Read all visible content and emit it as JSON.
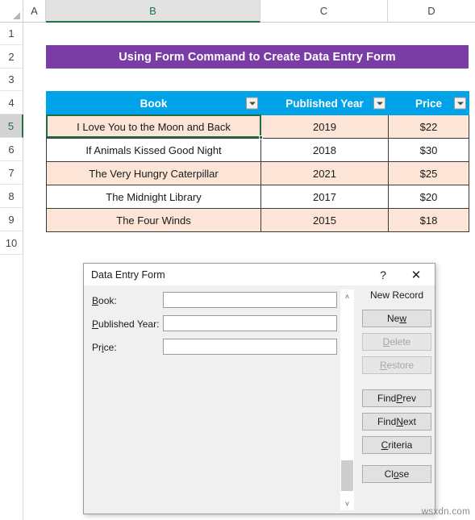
{
  "spreadsheet": {
    "columns": [
      {
        "label": "A",
        "active": false
      },
      {
        "label": "B",
        "active": true
      },
      {
        "label": "C",
        "active": false
      },
      {
        "label": "D",
        "active": false
      }
    ],
    "rows": [
      "1",
      "2",
      "3",
      "4",
      "5",
      "6",
      "7",
      "8",
      "9",
      "10"
    ],
    "active_row": "5",
    "active_cell": "B5",
    "banner_title": "Using Form Command to Create Data Entry Form",
    "banner_color": "#7a3da5",
    "header_color": "#00a2e8",
    "shade_color": "#fce4d6",
    "active_border_color": "#1f6b43",
    "table": {
      "headers": [
        "Book",
        "Published Year",
        "Price"
      ],
      "rows": [
        [
          "I Love You to the Moon and Back",
          "2019",
          "$22"
        ],
        [
          "If Animals Kissed Good Night",
          "2018",
          "$30"
        ],
        [
          "The Very Hungry Caterpillar",
          "2021",
          "$25"
        ],
        [
          "The Midnight Library",
          "2017",
          "$20"
        ],
        [
          "The Four Winds",
          "2015",
          "$18"
        ]
      ]
    }
  },
  "dialog": {
    "title": "Data Entry Form",
    "help_icon": "?",
    "close_icon": "✕",
    "fields": [
      {
        "label": "Book:",
        "accel": "B",
        "value": "",
        "placeholder": ""
      },
      {
        "label": "Published Year:",
        "accel": "P",
        "value": "",
        "placeholder": ""
      },
      {
        "label": "Price:",
        "accel": "i",
        "value": "",
        "placeholder": ""
      }
    ],
    "record_status": "New Record",
    "scroll_up_icon": "˄",
    "scroll_down_icon": "˅",
    "buttons": [
      {
        "label": "New",
        "accel": "w",
        "enabled": true
      },
      {
        "label": "Delete",
        "accel": "D",
        "enabled": false
      },
      {
        "label": "Restore",
        "accel": "R",
        "enabled": false
      },
      {
        "label": "Find Prev",
        "accel": "P",
        "enabled": true
      },
      {
        "label": "Find Next",
        "accel": "N",
        "enabled": true
      },
      {
        "label": "Criteria",
        "accel": "C",
        "enabled": true
      },
      {
        "label": "Close",
        "accel": "o",
        "enabled": true
      }
    ]
  },
  "watermark": "wsxdn.com"
}
